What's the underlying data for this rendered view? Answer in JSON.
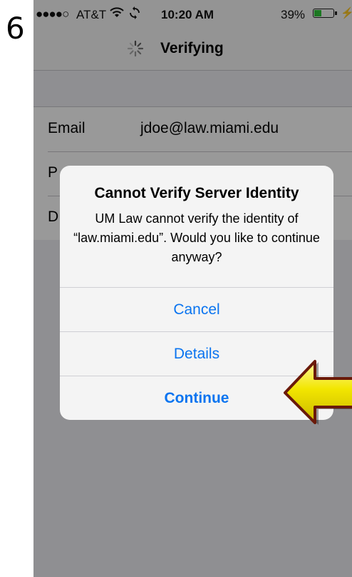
{
  "step": {
    "number": "6"
  },
  "status_bar": {
    "signal": "●●●●○",
    "carrier": "AT&T",
    "time": "10:20 AM",
    "battery_percent": "39%",
    "battery_level": 0.39
  },
  "nav": {
    "title": "Verifying"
  },
  "form": {
    "rows": [
      {
        "label": "Email",
        "value": "jdoe@law.miami.edu"
      },
      {
        "label": "P",
        "value": ""
      },
      {
        "label": "D",
        "value": ""
      }
    ]
  },
  "alert": {
    "title": "Cannot Verify Server Identity",
    "message": "UM Law cannot verify the identity of “law.miami.edu”. Would you like to continue anyway?",
    "buttons": {
      "cancel": "Cancel",
      "details": "Details",
      "continue": "Continue"
    }
  },
  "colors": {
    "accent": "#0a74f0",
    "arrow_fill": "#f2e600",
    "arrow_outline": "#6a1a0a",
    "battery": "#30c83a"
  }
}
